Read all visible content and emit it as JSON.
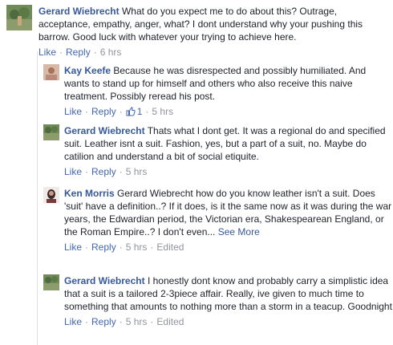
{
  "comments": [
    {
      "name": "Gerard Wiebrecht",
      "text": "What do you expect me to do about this? Outrage, acceptance, empathy, anger, what? I dont understand why your pushing this barrow. Good luck with whatever your trying to achieve here.",
      "like": "Like",
      "reply": "Reply",
      "time": "6 hrs"
    },
    {
      "name": "Kay Keefe",
      "text": "Because he was disrespected and possibly humiliated. And wants to stand up for himself and others who also receive this naive treatment. Possibly reread his post.",
      "like": "Like",
      "reply": "Reply",
      "likes_count": "1",
      "time": "5 hrs"
    },
    {
      "name": "Gerard Wiebrecht",
      "text": "Thats what I dont get. It was a regional do and specified suit. Leather isnt a suit. Fashion, yes, but a part of a suit, no. Maybe do catilion and understand a bit of social etiquite.",
      "like": "Like",
      "reply": "Reply",
      "time": "5 hrs"
    },
    {
      "name": "Ken Morris",
      "text": "Gerard Wiebrecht how do you know leather isn't a suit. Does 'suit' have a definition..? If it does, is it the same now as it was during the war years, the Edwardian period, the Victorian era, Shakespearean England, or the Roman Empire..? I don't even...",
      "see_more": "See More",
      "like": "Like",
      "reply": "Reply",
      "time": "5 hrs",
      "edited": "Edited"
    },
    {
      "name": "Gerard Wiebrecht",
      "text": "I honestly dont know and probably carry a simplistic idea that a suit is a tailored 2-3piece affair. Really, ive given to much time to something that amounts to nothing more than a storm in a teacup. Goodnight",
      "like": "Like",
      "reply": "Reply",
      "time": "5 hrs",
      "edited": "Edited"
    }
  ],
  "colors": {
    "name": "#365899",
    "link": "#4267b2",
    "meta": "#90949c",
    "text": "#1d2129"
  }
}
